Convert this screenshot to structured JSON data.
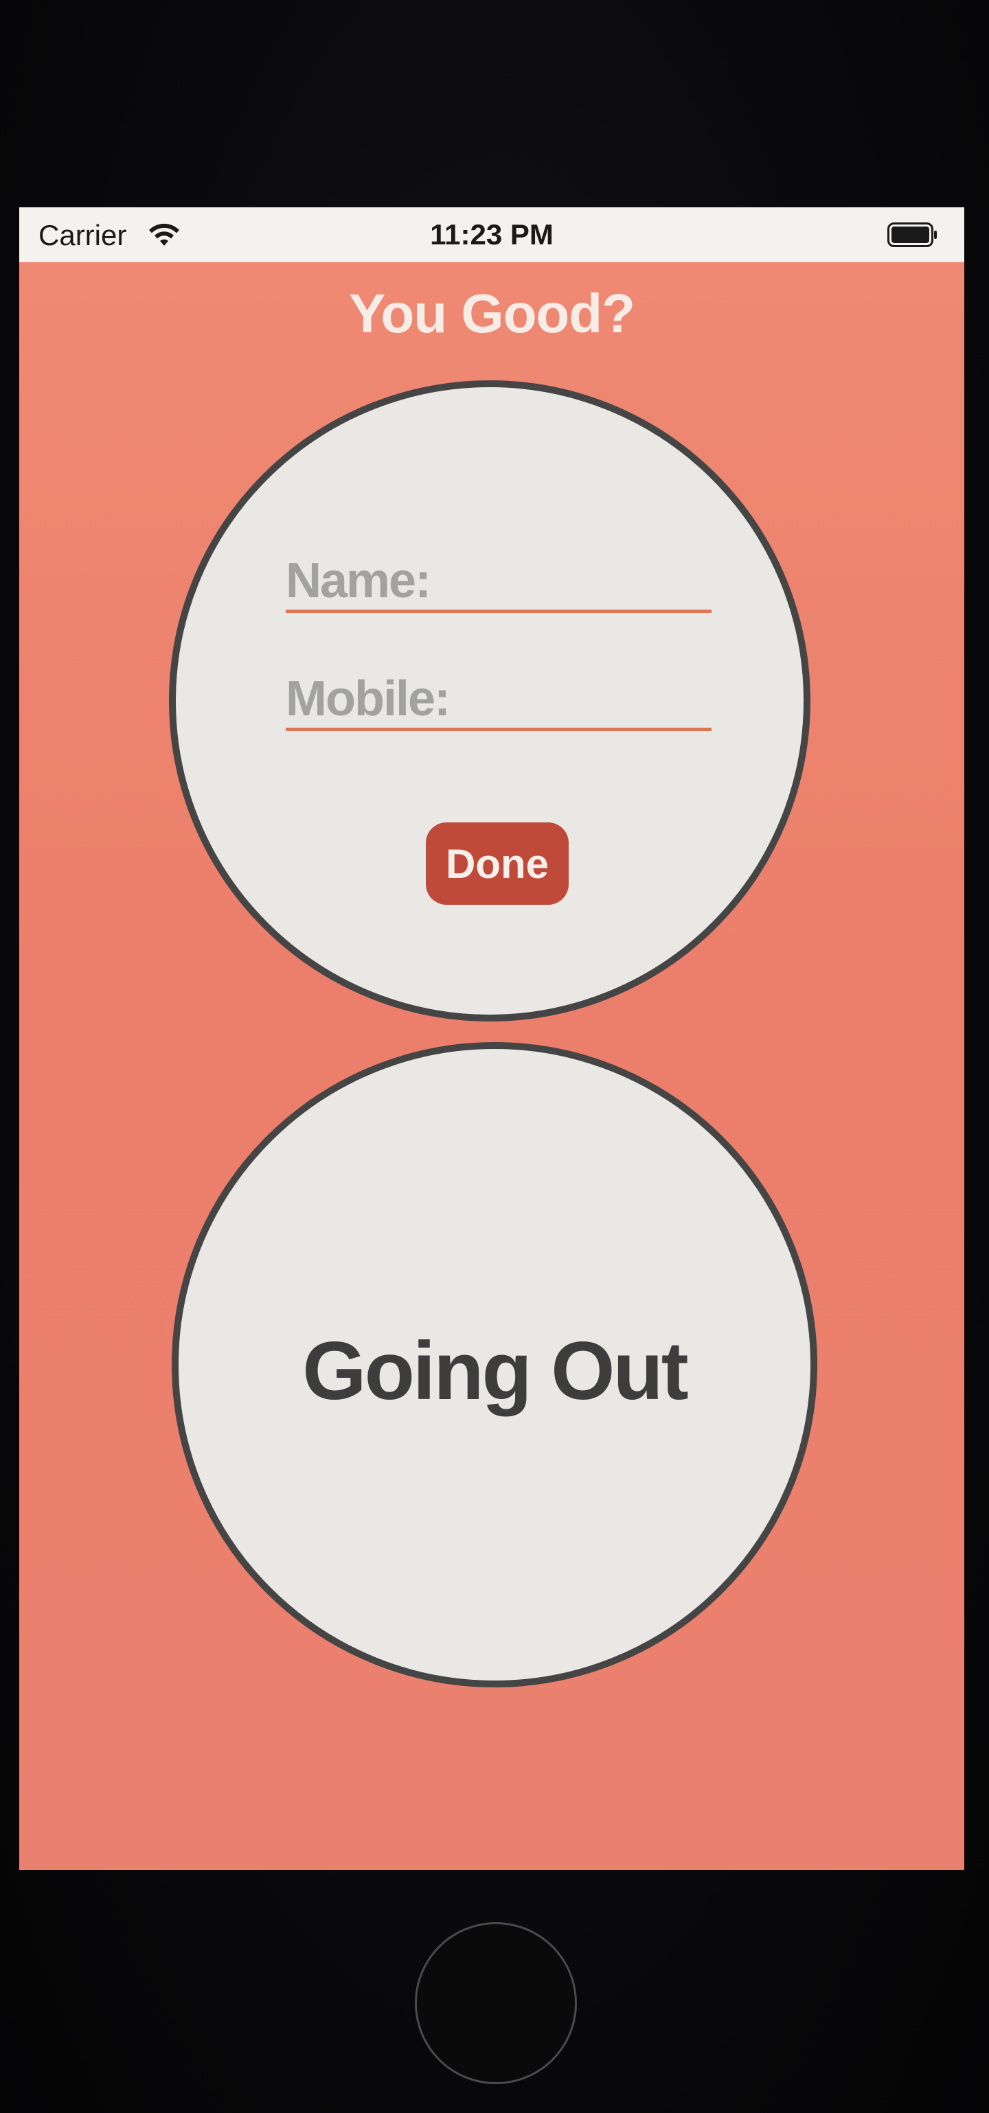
{
  "status_bar": {
    "carrier": "Carrier",
    "time": "11:23 PM",
    "wifi_icon": "wifi-icon",
    "battery_icon": "battery-icon"
  },
  "app": {
    "title": "You Good?"
  },
  "form": {
    "name_placeholder": "Name:",
    "mobile_placeholder": "Mobile:",
    "done_label": "Done"
  },
  "going_out": {
    "label": "Going Out"
  },
  "colors": {
    "background": "#ee8470",
    "circle_fill": "#e9e8e4",
    "circle_border": "#454545",
    "accent": "#bf4a3a",
    "underline": "#e07556"
  },
  "device": {
    "home_button_icon": "home-button-icon"
  }
}
